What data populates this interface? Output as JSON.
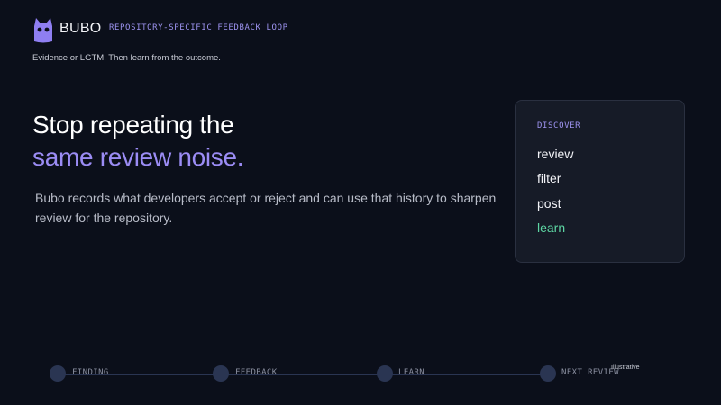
{
  "header": {
    "brand": "BUBO",
    "tagline": "REPOSITORY-SPECIFIC FEEDBACK LOOP",
    "subtagline": "Evidence or LGTM. Then learn from the outcome.",
    "logo_icon": "owl-icon",
    "logo_color": "#8f7ff2"
  },
  "hero": {
    "title_line1": "Stop repeating the",
    "title_line2": "same review noise.",
    "description": "Bubo records what developers accept or reject and can use that history to sharpen review for the repository."
  },
  "card": {
    "title": "DISCOVER",
    "items": [
      {
        "label": "review",
        "active": false
      },
      {
        "label": "filter",
        "active": false
      },
      {
        "label": "post",
        "active": false
      },
      {
        "label": "learn",
        "active": true
      }
    ],
    "active_color": "#5dd6a3"
  },
  "timeline": {
    "steps": [
      "FINDING",
      "FEEDBACK",
      "LEARN",
      "NEXT REVIEW"
    ],
    "note": "Illustrative"
  },
  "colors": {
    "background": "#0b0f1a",
    "accent": "#9b8cf4"
  }
}
